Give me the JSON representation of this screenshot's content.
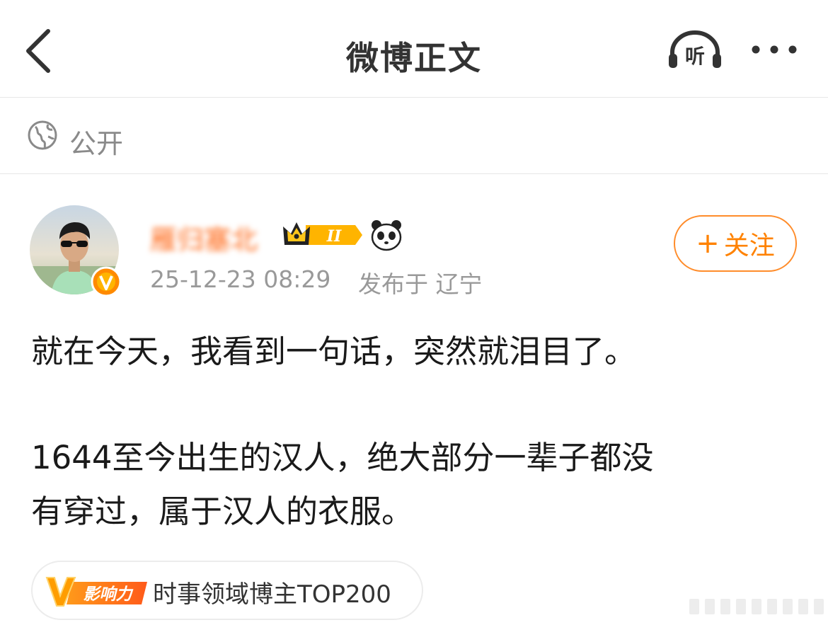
{
  "navbar": {
    "title": "微博正文",
    "listen_label": "听"
  },
  "visibility": {
    "label": "公开"
  },
  "author": {
    "name": "雁归塞北",
    "time": "25-12-23 08:29",
    "location": "发布于 辽宁",
    "vip_level": "II"
  },
  "follow": {
    "label": "关注"
  },
  "post": {
    "line1": "就在今天，我看到一句话，突然就泪目了。",
    "line2": "1644至今出生的汉人，绝大部分一辈子都没",
    "line3": "有穿过，属于汉人的衣服。"
  },
  "influence": {
    "badge_label": "影响力",
    "text": "时事领域博主TOP200"
  },
  "icons": {
    "back": "chevron-left-icon",
    "listen": "headphones-icon",
    "more": "more-dots-icon",
    "visibility": "globe-icon",
    "verified": "verified-v-icon",
    "vip": "crown-icon",
    "panda": "panda-icon",
    "influence": "v-badge-icon"
  },
  "colors": {
    "accent": "#ff8200",
    "meta_gray": "#999999",
    "title_gray": "#333333",
    "border": "#e6e6e6"
  }
}
